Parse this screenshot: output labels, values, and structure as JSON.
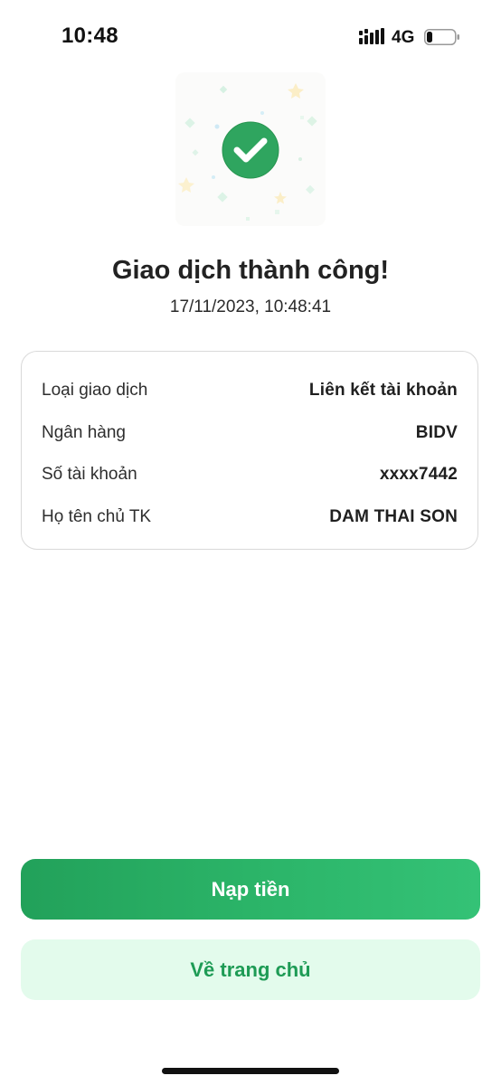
{
  "status_bar": {
    "time": "10:48",
    "network": "4G",
    "battery_icon": "battery-low-icon",
    "signal_icon": "cellular-signal-icon"
  },
  "illustration": {
    "icon": "check-circle-icon",
    "accent_color": "#2fa55f"
  },
  "result": {
    "title": "Giao dịch thành công!",
    "timestamp": "17/11/2023, 10:48:41"
  },
  "details": [
    {
      "label": "Loại giao dịch",
      "value": "Liên kết tài khoản"
    },
    {
      "label": "Ngân hàng",
      "value": "BIDV"
    },
    {
      "label": "Số tài khoản",
      "value": "xxxx7442"
    },
    {
      "label": "Họ tên chủ TK",
      "value": "DAM THAI SON"
    }
  ],
  "actions": {
    "primary_label": "Nạp tiền",
    "secondary_label": "Về trang chủ",
    "primary_color": "#2bb468",
    "secondary_bg": "#e3fbec"
  }
}
